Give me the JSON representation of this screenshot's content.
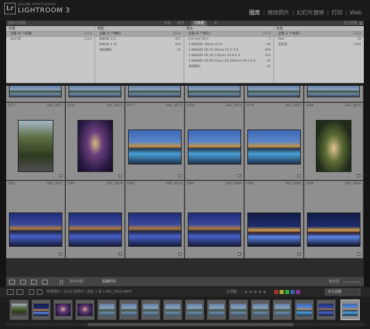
{
  "brand": {
    "small": "ADOBE PHOTOSHOP",
    "main": "LIGHTROOM 3",
    "logo": "Lr"
  },
  "modules": [
    {
      "label": "图库",
      "active": true
    },
    {
      "label": "修改照片",
      "active": false
    },
    {
      "label": "幻灯片放映",
      "active": false
    },
    {
      "label": "打印",
      "active": false
    },
    {
      "label": "Web",
      "active": false
    }
  ],
  "filterbar": {
    "title": "图库过滤器:",
    "options": [
      "文本",
      "属性",
      "元数据",
      "无"
    ],
    "active_option": "元数据",
    "right": "无过滤器"
  },
  "meta_columns": [
    {
      "header": "日期",
      "rows": [
        {
          "label": "全部 (8 个日期)",
          "count": "1110",
          "selected": true
        },
        {
          "label": "2011年",
          "count": "1110",
          "selected": false
        }
      ]
    },
    {
      "header": "相机",
      "rows": [
        {
          "label": "全部 (3 个相机)",
          "count": "1110",
          "selected": true
        },
        {
          "label": "NIKON 1 J1",
          "count": "415",
          "selected": false
        },
        {
          "label": "NIKON 1 V1",
          "count": "650",
          "selected": false
        },
        {
          "label": "未知相机",
          "count": "45",
          "selected": false
        }
      ]
    },
    {
      "header": "镜头",
      "rows": [
        {
          "label": "全部 (6 个镜头)",
          "count": "1110",
          "selected": true
        },
        {
          "label": "0.0 mm f/0.0",
          "count": "7",
          "selected": false
        },
        {
          "label": "1 NIKKOR 10mm f/2.8",
          "count": "98",
          "selected": false
        },
        {
          "label": "1 NIKKOR VR 10-30mm f/3.5-5.6",
          "count": "608",
          "selected": false
        },
        {
          "label": "1 NIKKOR VR 30-110mm f/3.8-5.6",
          "count": "430",
          "selected": false
        },
        {
          "label": "1 NIKKOR VR PD-Zoom 10-100mm f/4.5-5.6",
          "count": "46",
          "selected": false
        },
        {
          "label": "未知镜头",
          "count": "41",
          "selected": false
        }
      ]
    },
    {
      "header": "标签",
      "rows": [
        {
          "label": "全部 (2 个标签)",
          "count": "1110",
          "selected": true
        },
        {
          "label": "Red",
          "count": "16",
          "selected": false
        },
        {
          "label": "无标签",
          "count": "1094",
          "selected": false
        }
      ]
    }
  ],
  "grid": {
    "row1": [
      {
        "num": "1075",
        "name": "DSC_0671",
        "photo": "trees"
      },
      {
        "num": "1076",
        "name": "DSC_0672",
        "photo": "tunnel"
      },
      {
        "num": "1077",
        "name": "DSC_0673",
        "photo": "palace"
      },
      {
        "num": "1078",
        "name": "DSC_0674",
        "photo": "palace"
      },
      {
        "num": "1079",
        "name": "DSC_0675",
        "photo": "palace"
      },
      {
        "num": "1080",
        "name": "DSC_0676",
        "photo": "arch"
      }
    ],
    "row2": [
      {
        "num": "1081",
        "name": "DSC_0677",
        "photo": "palace2"
      },
      {
        "num": "1082",
        "name": "DSC_0678",
        "photo": "palace2"
      },
      {
        "num": "1083",
        "name": "DSC_0679",
        "photo": "palace2"
      },
      {
        "num": "1084",
        "name": "DSC_0680",
        "photo": "palace2"
      },
      {
        "num": "1085",
        "name": "DSC_0681",
        "photo": "night"
      },
      {
        "num": "1086",
        "name": "DSC_0682",
        "photo": "night"
      }
    ]
  },
  "toolbar": {
    "sort_label": "排序依据:",
    "sort_value": "拍摄时间",
    "right_label": "缩览图"
  },
  "filmstrip_bar": {
    "nav": "所有照片 / 1110 张照片 / 选定 1 张 / DSC_0616.MOV",
    "filter_label": "过滤器:",
    "stars": "★★★★★",
    "filter_value": "无过滤器"
  },
  "filmstrip": [
    "trees",
    "night",
    "tunnel",
    "tunnel",
    "water",
    "water",
    "water",
    "water",
    "water",
    "water",
    "water",
    "water",
    "water",
    "palace",
    "palace",
    "palace2",
    "palace"
  ]
}
